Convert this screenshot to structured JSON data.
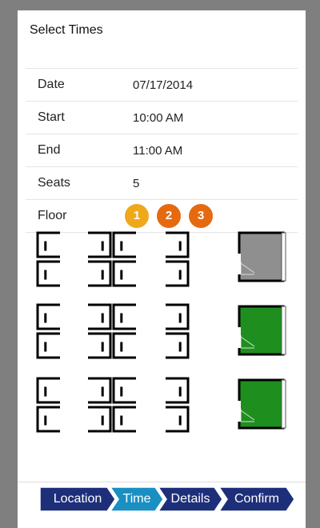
{
  "header": {
    "title": "Select Times"
  },
  "form": {
    "date": {
      "label": "Date",
      "value": "07/17/2014"
    },
    "start": {
      "label": "Start",
      "value": "10:00 AM"
    },
    "end": {
      "label": "End",
      "value": "11:00 AM"
    },
    "seats": {
      "label": "Seats",
      "value": "5"
    },
    "floor": {
      "label": "Floor",
      "options": [
        "1",
        "2",
        "3"
      ],
      "selected": "1"
    }
  },
  "colors": {
    "floor_selected": "#f0a81b",
    "floor_other": "#e56a0f",
    "room_available": "#1e8f1e",
    "room_unavailable": "#8f8f8f",
    "wizard_dark": "#1e2f7a",
    "wizard_active": "#1a8fc2"
  },
  "rooms": [
    {
      "status": "unavailable"
    },
    {
      "status": "available"
    },
    {
      "status": "available"
    }
  ],
  "wizard": {
    "steps": [
      {
        "label": "Location",
        "active": false
      },
      {
        "label": "Time",
        "active": true
      },
      {
        "label": "Details",
        "active": false
      },
      {
        "label": "Confirm",
        "active": false
      }
    ]
  }
}
